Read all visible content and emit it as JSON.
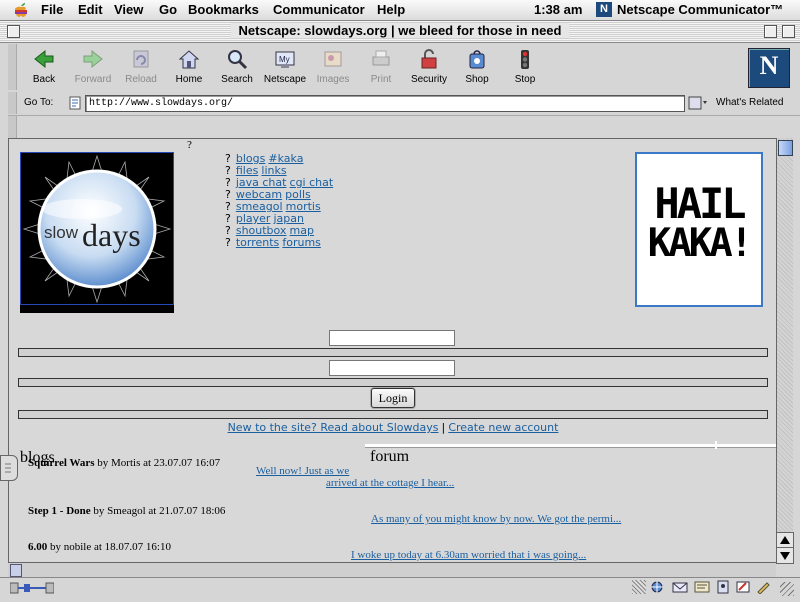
{
  "menubar": {
    "items": [
      "File",
      "Edit",
      "View",
      "Go",
      "Bookmarks",
      "Communicator",
      "Help"
    ],
    "clock": "1:38 am",
    "app_name": "Netscape Communicator™"
  },
  "window": {
    "title": "Netscape: slowdays.org | we bleed for those in need"
  },
  "toolbar": {
    "buttons": [
      {
        "label": "Back",
        "icon": "back-arrow-icon",
        "enabled": true
      },
      {
        "label": "Forward",
        "icon": "forward-arrow-icon",
        "enabled": false
      },
      {
        "label": "Reload",
        "icon": "reload-icon",
        "enabled": false
      },
      {
        "label": "Home",
        "icon": "home-icon",
        "enabled": true
      },
      {
        "label": "Search",
        "icon": "search-icon",
        "enabled": true
      },
      {
        "label": "Netscape",
        "icon": "my-netscape-icon",
        "enabled": true
      },
      {
        "label": "Images",
        "icon": "images-icon",
        "enabled": false
      },
      {
        "label": "Print",
        "icon": "print-icon",
        "enabled": false
      },
      {
        "label": "Security",
        "icon": "security-lock-icon",
        "enabled": true
      },
      {
        "label": "Shop",
        "icon": "shop-icon",
        "enabled": true
      },
      {
        "label": "Stop",
        "icon": "stop-icon",
        "enabled": true
      }
    ]
  },
  "location": {
    "label": "Go To:",
    "url": "http://www.slowdays.org/",
    "whats_related": "What's Related"
  },
  "page": {
    "stray_mark": "?",
    "logo_text_slow": "slow",
    "logo_text_days": "days",
    "nav_rows": [
      [
        "blogs",
        "#kaka"
      ],
      [
        "files",
        "links"
      ],
      [
        "java chat",
        "cgi chat"
      ],
      [
        "webcam",
        "polls"
      ],
      [
        "smeagol",
        "mortis"
      ],
      [
        "player",
        "japan"
      ],
      [
        "shoutbox",
        "map"
      ],
      [
        "torrents",
        "forums"
      ]
    ],
    "bullet": "?",
    "banner_line1": "HAIL",
    "banner_line2": "KAKA!",
    "login_label": "Login",
    "new_to_site": "New to the site? Read about Slowdays",
    "separator": "|",
    "create_account": "Create new account",
    "blogs_heading": "blogs",
    "forum_heading": "forum",
    "blog_entries": [
      {
        "title": "Squirrel Wars",
        "by": "by Mortis at 23.07.07 16:07"
      },
      {
        "title": "Step 1 - Done",
        "by": "by Smeagol at 21.07.07 18:06"
      },
      {
        "title": "6.00",
        "by": "by nobile at 18.07.07 16:10"
      }
    ],
    "forum_posts": [
      "Well now! Just as we",
      "arrived at the cottage I hear...",
      "As many of you might know by now. We got the permi...",
      "I woke up today at 6.30am worried that i was going..."
    ]
  }
}
